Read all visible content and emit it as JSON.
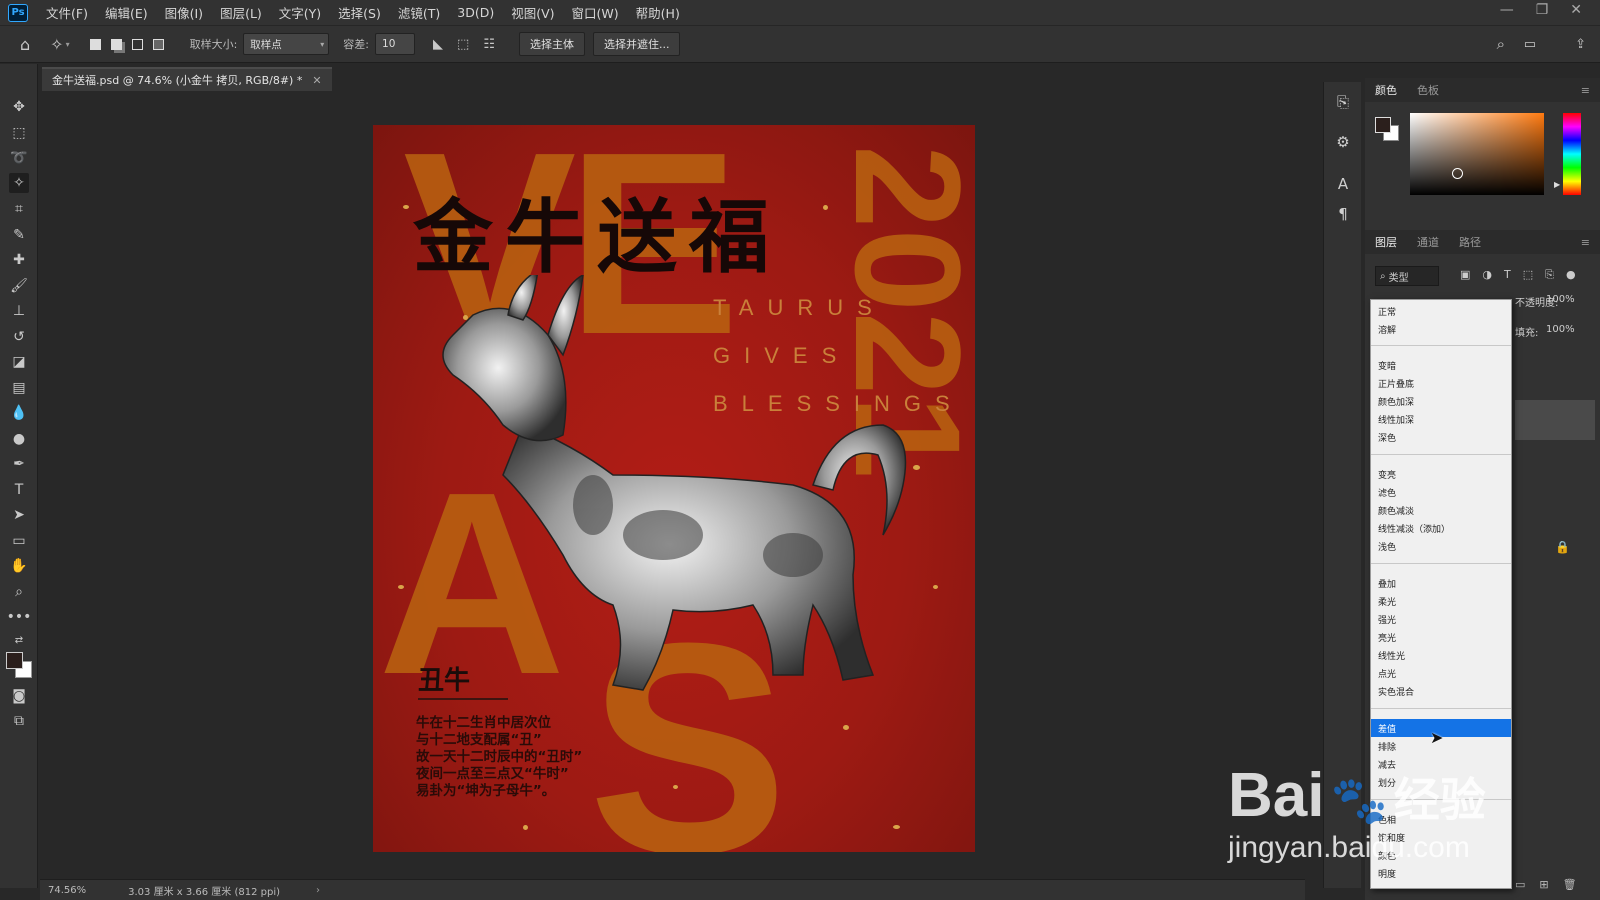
{
  "app": {
    "logo": "Ps",
    "menu": [
      "文件(F)",
      "编辑(E)",
      "图像(I)",
      "图层(L)",
      "文字(Y)",
      "选择(S)",
      "滤镜(T)",
      "3D(D)",
      "视图(V)",
      "窗口(W)",
      "帮助(H)"
    ]
  },
  "options": {
    "sample_size_label": "取样大小:",
    "sample_size_value": "取样点",
    "tolerance_label": "容差:",
    "tolerance_value": "10",
    "select_subject": "选择主体",
    "select_and_mask": "选择并遮住..."
  },
  "document": {
    "tab_title": "金牛送福.psd @ 74.6% (小金牛 拷贝, RGB/8#) *",
    "zoom": "74.56%",
    "doc_size": "3.03 厘米 x 3.66 厘米 (812 ppi)"
  },
  "poster": {
    "title": "金牛送福",
    "year": "2021",
    "english_lines": [
      "TAURUS",
      "GIVES",
      "BLESSINGS"
    ],
    "bg_letters": [
      "VE",
      "A",
      "S"
    ],
    "chou": "丑牛",
    "description": [
      "牛在十二生肖中居次位",
      "与十二地支配属“丑”",
      "故一天十二时辰中的“丑时”",
      "夜间一点至三点又“牛时”",
      "易卦为“坤为子母牛”。"
    ]
  },
  "color_panel": {
    "tabs": [
      "颜色",
      "色板"
    ],
    "colors": {
      "foreground": "#2b1f1c",
      "background": "#ffffff"
    }
  },
  "layers_panel": {
    "tabs": [
      "图层",
      "通道",
      "路径"
    ],
    "filter_label": "类型",
    "opacity_label": "不透明度:",
    "opacity_value": "100%",
    "fill_label": "填充:",
    "fill_value": "100%"
  },
  "blend_modes": {
    "groups": [
      [
        "正常",
        "溶解"
      ],
      [
        "变暗",
        "正片叠底",
        "颜色加深",
        "线性加深",
        "深色"
      ],
      [
        "变亮",
        "滤色",
        "颜色减淡",
        "线性减淡（添加）",
        "浅色"
      ],
      [
        "叠加",
        "柔光",
        "强光",
        "亮光",
        "线性光",
        "点光",
        "实色混合"
      ],
      [
        "差值",
        "排除",
        "减去",
        "划分"
      ],
      [
        "色相",
        "饱和度",
        "颜色",
        "明度"
      ]
    ],
    "selected": "差值"
  },
  "watermark": {
    "brand": "Bai",
    "brand_suffix": "经验",
    "url": "jingyan.baidu.com"
  }
}
